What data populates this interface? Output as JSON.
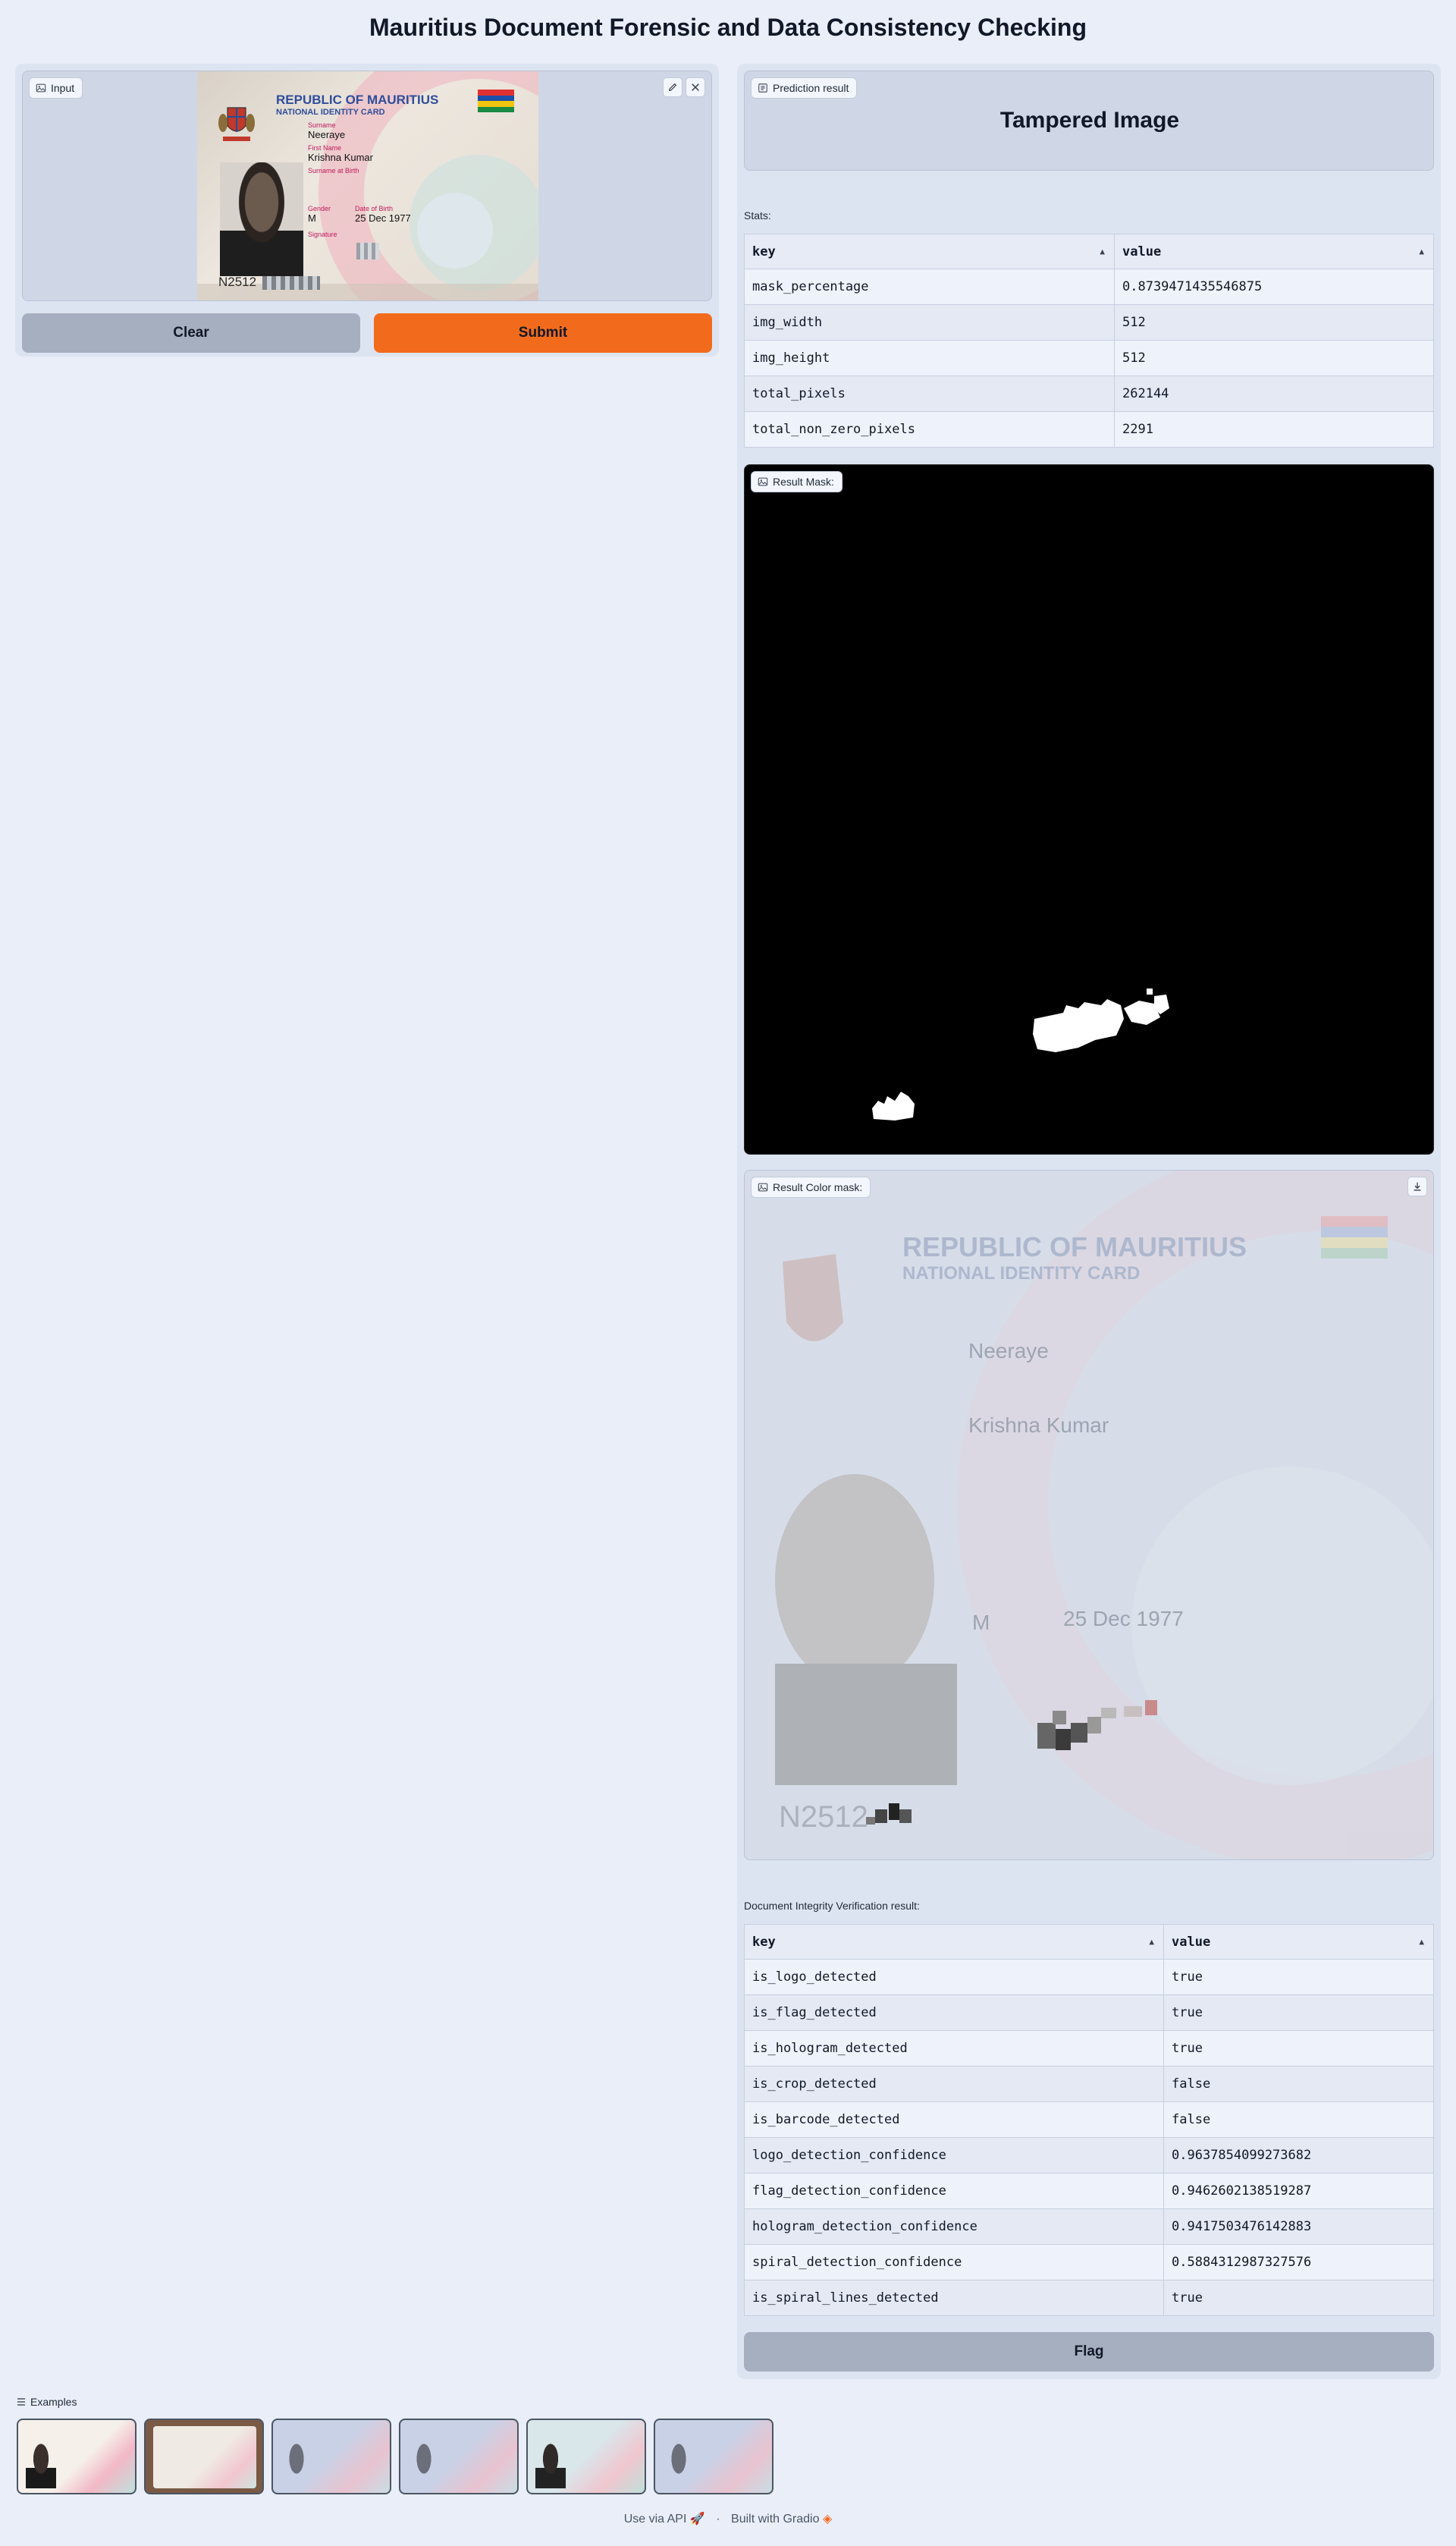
{
  "page": {
    "title": "Mauritius Document Forensic and Data Consistency Checking"
  },
  "input": {
    "label": "Input",
    "card": {
      "country": "REPUBLIC OF MAURITIUS",
      "card_type": "NATIONAL IDENTITY CARD",
      "surname_label": "Surname",
      "surname": "Neeraye",
      "first_name_label": "First Name",
      "first_name": "Krishna Kumar",
      "surname_at_birth_label": "Surname at Birth",
      "gender_label": "Gender",
      "gender": "M",
      "dob_label": "Date of Birth",
      "dob": "25 Dec 1977",
      "signature_label": "Signature",
      "id_number": "N2512"
    }
  },
  "buttons": {
    "clear": "Clear",
    "submit": "Submit",
    "flag": "Flag"
  },
  "prediction": {
    "label": "Prediction result",
    "value": "Tampered Image"
  },
  "stats": {
    "label": "Stats:",
    "headers": [
      "key",
      "value"
    ],
    "rows": [
      [
        "mask_percentage",
        "0.8739471435546875"
      ],
      [
        "img_width",
        "512"
      ],
      [
        "img_height",
        "512"
      ],
      [
        "total_pixels",
        "262144"
      ],
      [
        "total_non_zero_pixels",
        "2291"
      ]
    ]
  },
  "result_mask": {
    "label": "Result Mask:"
  },
  "result_color_mask": {
    "label": "Result Color mask:"
  },
  "integrity": {
    "label": "Document Integrity Verification result:",
    "headers": [
      "key",
      "value"
    ],
    "rows": [
      [
        "is_logo_detected",
        "true"
      ],
      [
        "is_flag_detected",
        "true"
      ],
      [
        "is_hologram_detected",
        "true"
      ],
      [
        "is_crop_detected",
        "false"
      ],
      [
        "is_barcode_detected",
        "false"
      ],
      [
        "logo_detection_confidence",
        "0.9637854099273682"
      ],
      [
        "flag_detection_confidence",
        "0.9462602138519287"
      ],
      [
        "hologram_detection_confidence",
        "0.9417503476142883"
      ],
      [
        "spiral_detection_confidence",
        "0.5884312987327576"
      ],
      [
        "is_spiral_lines_detected",
        "true"
      ]
    ]
  },
  "examples": {
    "label": "Examples",
    "count": 6
  },
  "footer": {
    "api": "Use via API",
    "separator": "·",
    "built": "Built with Gradio"
  },
  "colors": {
    "accent": "#f26b1d",
    "secondary": "#a6afc0",
    "background": "#e9eef9"
  }
}
